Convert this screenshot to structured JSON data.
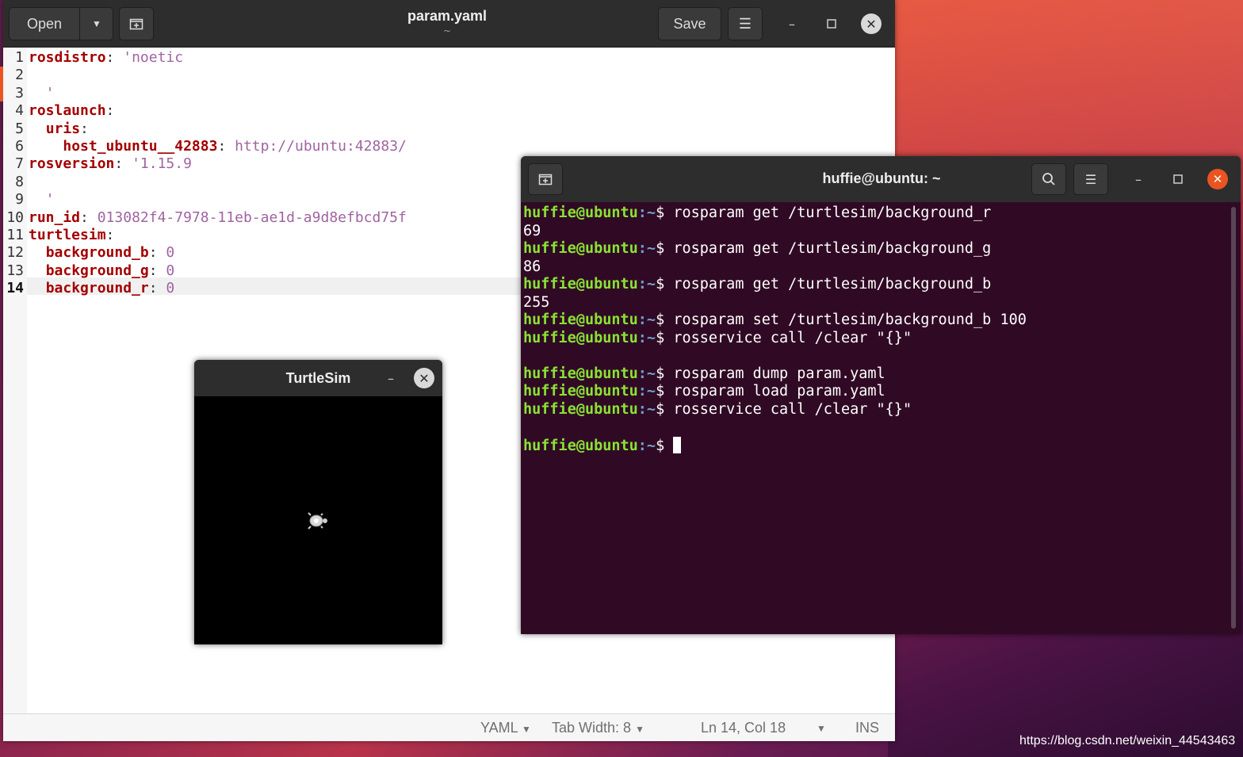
{
  "gedit": {
    "open_label": "Open",
    "save_label": "Save",
    "title": "param.yaml",
    "subtitle": "~",
    "lines": [
      {
        "num": "1",
        "key": "rosdistro",
        "sep": ": ",
        "val": "'noetic",
        "indent": ""
      },
      {
        "num": "2",
        "key": "",
        "sep": "",
        "val": "",
        "indent": ""
      },
      {
        "num": "3",
        "key": "",
        "sep": "",
        "val": "  '",
        "indent": ""
      },
      {
        "num": "4",
        "key": "roslaunch",
        "sep": ":",
        "val": "",
        "indent": ""
      },
      {
        "num": "5",
        "key": "uris",
        "sep": ":",
        "val": "",
        "indent": "  "
      },
      {
        "num": "6",
        "key": "host_ubuntu__42883",
        "sep": ": ",
        "val": "http://ubuntu:42883/",
        "indent": "    "
      },
      {
        "num": "7",
        "key": "rosversion",
        "sep": ": ",
        "val": "'1.15.9",
        "indent": ""
      },
      {
        "num": "8",
        "key": "",
        "sep": "",
        "val": "",
        "indent": ""
      },
      {
        "num": "9",
        "key": "",
        "sep": "",
        "val": "  '",
        "indent": ""
      },
      {
        "num": "10",
        "key": "run_id",
        "sep": ": ",
        "val": "013082f4-7978-11eb-ae1d-a9d8efbcd75f",
        "indent": ""
      },
      {
        "num": "11",
        "key": "turtlesim",
        "sep": ":",
        "val": "",
        "indent": ""
      },
      {
        "num": "12",
        "key": "background_b",
        "sep": ": ",
        "val": "0",
        "indent": "  "
      },
      {
        "num": "13",
        "key": "background_g",
        "sep": ": ",
        "val": "0",
        "indent": "  "
      },
      {
        "num": "14",
        "key": "background_r",
        "sep": ": ",
        "val": "0",
        "indent": "  "
      }
    ],
    "status": {
      "language": "YAML",
      "tab_width": "Tab Width: 8",
      "position": "Ln 14, Col 18",
      "mode": "INS"
    }
  },
  "turtlesim": {
    "title": "TurtleSim"
  },
  "terminal": {
    "title": "huffie@ubuntu: ~",
    "prompt_user": "huffie@ubuntu",
    "prompt_path": ":~",
    "prompt_sign": "$ ",
    "lines": [
      {
        "type": "cmd",
        "text": "rosparam get /turtlesim/background_r"
      },
      {
        "type": "out",
        "text": "69"
      },
      {
        "type": "cmd",
        "text": "rosparam get /turtlesim/background_g"
      },
      {
        "type": "out",
        "text": "86"
      },
      {
        "type": "cmd",
        "text": "rosparam get /turtlesim/background_b"
      },
      {
        "type": "out",
        "text": "255"
      },
      {
        "type": "cmd",
        "text": "rosparam set /turtlesim/background_b 100"
      },
      {
        "type": "cmd",
        "text": "rosservice call /clear \"{}\""
      },
      {
        "type": "out",
        "text": ""
      },
      {
        "type": "cmd",
        "text": "rosparam dump param.yaml"
      },
      {
        "type": "cmd",
        "text": "rosparam load param.yaml"
      },
      {
        "type": "cmd",
        "text": "rosservice call /clear \"{}\""
      },
      {
        "type": "out",
        "text": ""
      },
      {
        "type": "cursor",
        "text": ""
      }
    ]
  },
  "watermark": "https://blog.csdn.net/weixin_44543463"
}
